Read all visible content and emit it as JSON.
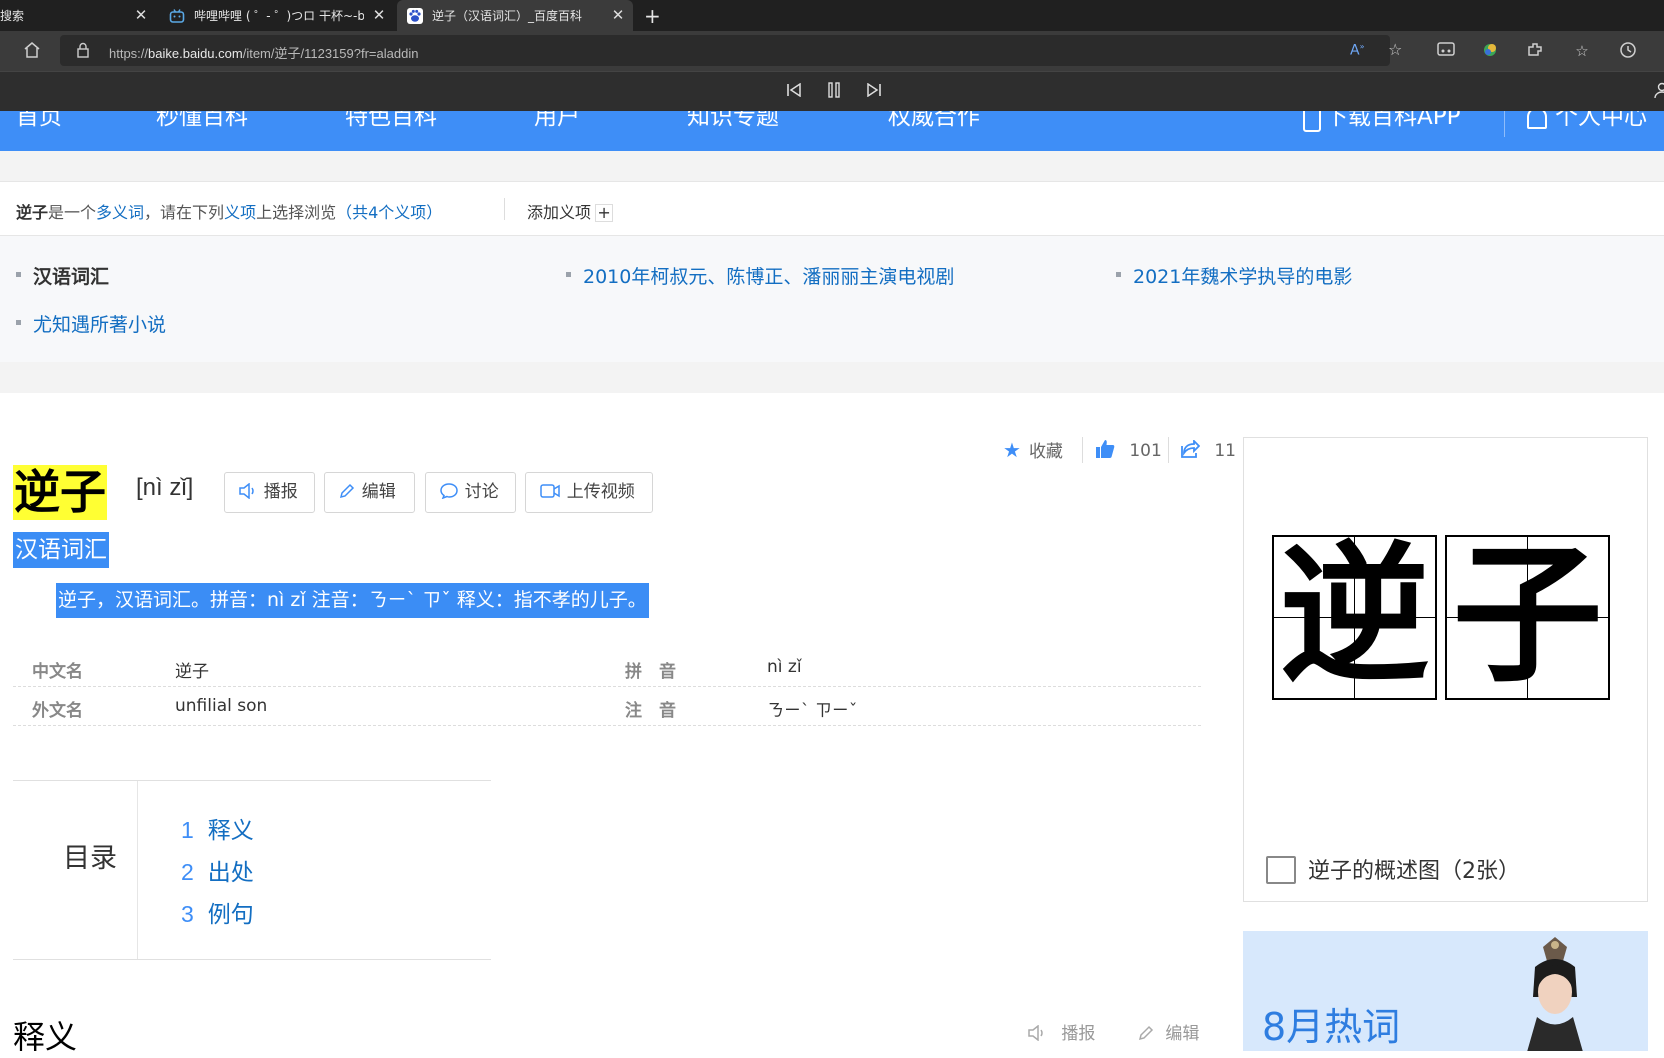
{
  "browser": {
    "tabs": [
      {
        "title": "搜索",
        "active": false
      },
      {
        "title": "哔哩哔哩 ( ゜- ゜)つロ 干杯~-bilib",
        "active": false
      },
      {
        "title": "逆子（汉语词汇）_百度百科",
        "active": true
      }
    ],
    "new_tab_label": "+",
    "url_prefix": "https://",
    "url_domain": "baike.baidu.com",
    "url_path": "/item/逆子/1123159?fr=aladdin"
  },
  "site_nav": {
    "items": [
      "首页",
      "秒懂百科",
      "特色百科",
      "用户",
      "知识专题",
      "权威合作"
    ],
    "download_app": "下载百科APP",
    "personal_center": "个人中心"
  },
  "polysemy": {
    "term": "逆子",
    "text_1": "是一个",
    "link_1": "多义词",
    "text_2": "，请在下列",
    "link_2": "义项",
    "text_3": "上选择浏览",
    "link_3": "（共4个义项）",
    "add_sense": "添加义项",
    "add_icon": "+",
    "senses": [
      "汉语词汇",
      "2010年柯叔元、陈博正、潘丽丽主演电视剧",
      "2021年魏术学执导的电影",
      "尤知遇所著小说"
    ]
  },
  "entry": {
    "title": "逆子",
    "pinyin": "[nì zǐ]",
    "buttons": [
      "播报",
      "编辑",
      "讨论",
      "上传视频"
    ],
    "subtitle": "汉语词汇",
    "summary": "逆子，汉语词汇。拼音：nì zǐ 注音：ㄋㄧˋ ㄗˇ 释义：指不孝的儿子。",
    "actions": {
      "collect": "收藏",
      "like_count": "101",
      "share_count": "11"
    }
  },
  "basic_info": [
    {
      "key": "中文名",
      "value": "逆子",
      "key2": "拼　音",
      "value2": "nì zǐ"
    },
    {
      "key": "外文名",
      "value": "unfilial son",
      "key2": "注　音",
      "value2": "ㄋㄧˋ ㄗㄧˇ"
    }
  ],
  "toc": {
    "label": "目录",
    "items": [
      {
        "num": "1",
        "text": "释义"
      },
      {
        "num": "2",
        "text": "出处"
      },
      {
        "num": "3",
        "text": "例句"
      }
    ]
  },
  "section": {
    "title": "释义",
    "read": "播报",
    "edit": "编辑"
  },
  "sidebar": {
    "chars": [
      "逆",
      "子"
    ],
    "image_caption": "逆子的概述图（2张）",
    "hot_title": "8月热词"
  },
  "colors": {
    "accent": "#3e8ef7",
    "link": "#136ec2",
    "highlight": "#ffff33",
    "selection": "#3b8df5"
  }
}
